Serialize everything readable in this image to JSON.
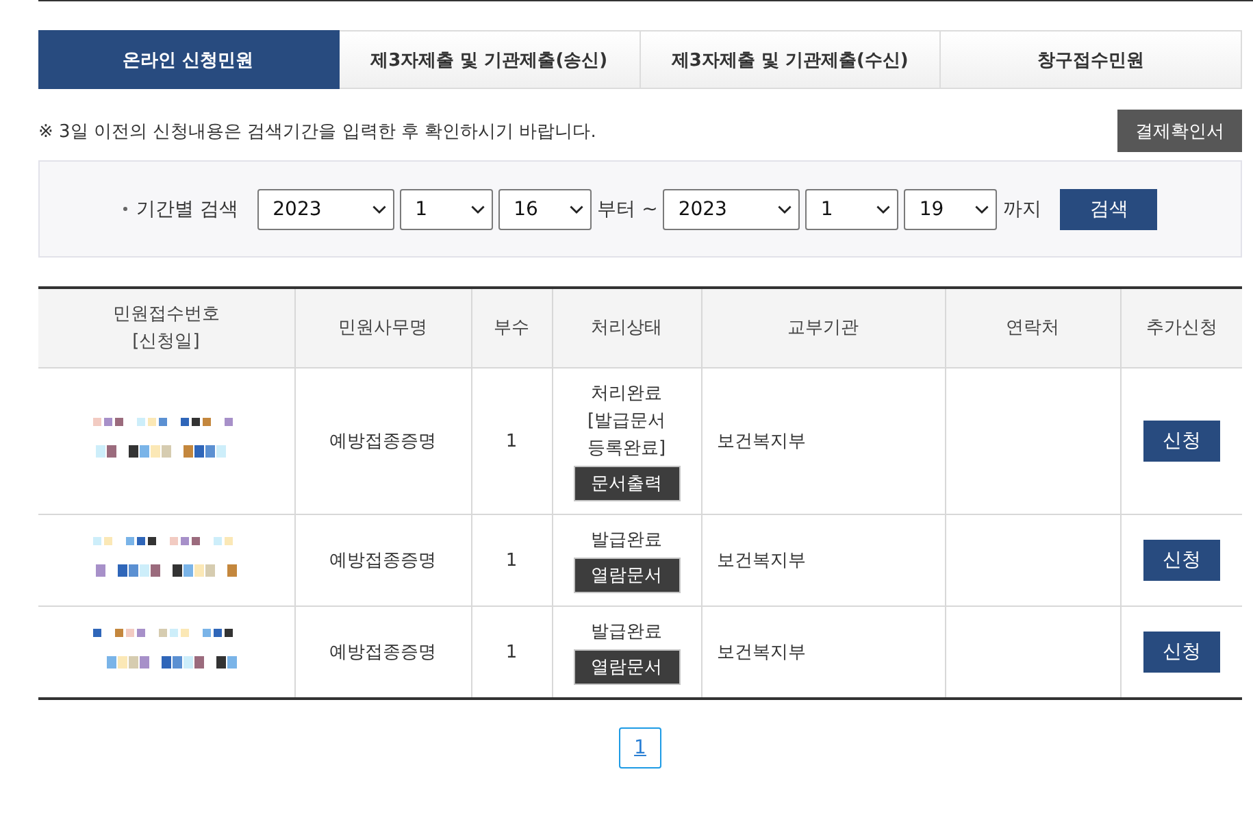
{
  "tabs": [
    {
      "label": "온라인 신청민원",
      "selected": true
    },
    {
      "label": "제3자제출 및 기관제출(송신)",
      "selected": false
    },
    {
      "label": "제3자제출 및 기관제출(수신)",
      "selected": false
    },
    {
      "label": "창구접수민원",
      "selected": false
    }
  ],
  "notice": "※ 3일 이전의 신청내용은 검색기간을 입력한 후 확인하시기 바랍니다.",
  "receipt_button": "결제확인서",
  "search": {
    "label": "기간별 검색",
    "from": {
      "year": "2023",
      "month": "1",
      "day": "16"
    },
    "from_suffix": "부터 ~",
    "to": {
      "year": "2023",
      "month": "1",
      "day": "19"
    },
    "to_suffix": "까지",
    "button": "검색"
  },
  "table": {
    "columns": [
      {
        "lines": [
          "민원접수번호",
          "[신청일]"
        ]
      },
      {
        "lines": [
          "민원사무명"
        ]
      },
      {
        "lines": [
          "부수"
        ]
      },
      {
        "lines": [
          "처리상태"
        ]
      },
      {
        "lines": [
          "교부기관"
        ]
      },
      {
        "lines": [
          "연락처"
        ]
      },
      {
        "lines": [
          "추가신청"
        ]
      }
    ],
    "rows": [
      {
        "service": "예방접종증명",
        "copies": "1",
        "status": [
          "처리완료",
          "[발급문서 등록완료]"
        ],
        "status_button": "문서출력",
        "agency": "보건복지부",
        "action": "신청"
      },
      {
        "service": "예방접종증명",
        "copies": "1",
        "status": [
          "발급완료"
        ],
        "status_button": "열람문서",
        "agency": "보건복지부",
        "action": "신청"
      },
      {
        "service": "예방접종증명",
        "copies": "1",
        "status": [
          "발급완료"
        ],
        "status_button": "열람문서",
        "agency": "보건복지부",
        "action": "신청"
      }
    ]
  },
  "pagination": [
    {
      "label": "1",
      "selected": true
    }
  ]
}
